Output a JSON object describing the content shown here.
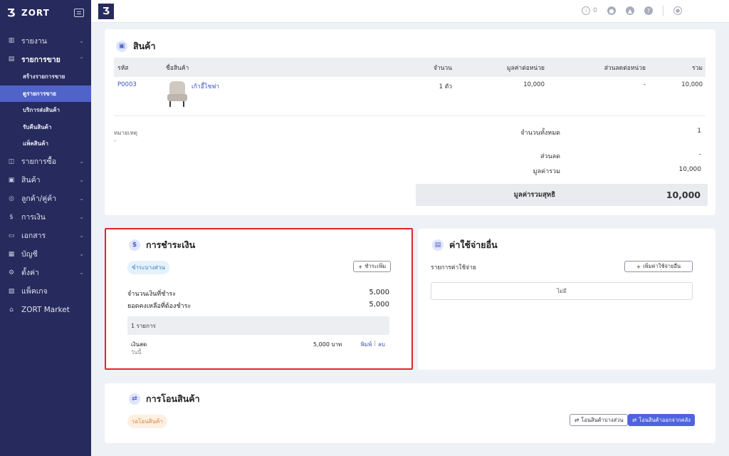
{
  "brand": {
    "name": "ZORT",
    "logo_glyph": "Ʒ"
  },
  "sidebar": {
    "items": [
      {
        "label": "รายงาน",
        "icon": "chart-bar-icon",
        "glyph": "▥"
      },
      {
        "label": "รายการขาย",
        "icon": "clipboard-icon",
        "glyph": "▤"
      },
      {
        "label": "รายการซื้อ",
        "icon": "basket-icon",
        "glyph": "◫"
      },
      {
        "label": "สินค้า",
        "icon": "box-icon",
        "glyph": "▣"
      },
      {
        "label": "ลูกค้า/คู่ค้า",
        "icon": "users-icon",
        "glyph": "◎"
      },
      {
        "label": "การเงิน",
        "icon": "dollar-circle-icon",
        "glyph": "$"
      },
      {
        "label": "เอกสาร",
        "icon": "document-icon",
        "glyph": "▭"
      },
      {
        "label": "บัญชี",
        "icon": "ledger-icon",
        "glyph": "▦"
      },
      {
        "label": "ตั้งค่า",
        "icon": "gear-icon",
        "glyph": "⚙"
      },
      {
        "label": "แพ็คเกจ",
        "icon": "package-icon",
        "glyph": "▧"
      },
      {
        "label": "ZORT Market",
        "icon": "shopping-bag-icon",
        "glyph": "⌂"
      }
    ],
    "sales_sub": [
      "สร้างรายการขาย",
      "ดูรายการขาย",
      "บริการส่งสินค้า",
      "รับคืนสินค้า",
      "แพ็คสินค้า"
    ]
  },
  "topbar": {
    "notification_count": "0"
  },
  "product": {
    "title": "สินค้า",
    "headers": {
      "code": "รหัส",
      "name": "ชื่อสินค้า",
      "qty": "จำนวน",
      "unit_price": "มูลค่าต่อหน่วย",
      "unit_discount": "ส่วนลดต่อหน่วย",
      "total": "รวม"
    },
    "row": {
      "code": "P0003",
      "name": "เก้าอี้โซฟา",
      "qty": "1 ตัว",
      "unit_price": "10,000",
      "unit_discount": "-",
      "total": "10,000"
    },
    "note_label": "หมายเหตุ",
    "note_value": "-",
    "summary": {
      "qty_label": "จำนวนทั้งหมด",
      "qty_value": "1",
      "discount_label": "ส่วนลด",
      "discount_value": "-",
      "subtotal_label": "มูลค่ารวม",
      "subtotal_value": "10,000",
      "net_label": "มูลค่ารวมสุทธิ",
      "net_value": "10,000"
    }
  },
  "payment": {
    "title": "การชำระเงิน",
    "status": "ชำระบางส่วน",
    "add_button": "ชำระเพิ่ม",
    "paid_label": "จำนวนเงินที่ชำระ",
    "paid_value": "5,000",
    "remaining_label": "ยอดคงเหลือที่ต้องชำระ",
    "remaining_value": "5,000",
    "list_header": "1 รายการ",
    "item": {
      "method": "เงินสด",
      "when": "วันนี้",
      "amount": "5,000 บาท",
      "print": "พิมพ์",
      "delete": "ลบ"
    }
  },
  "expense": {
    "title": "ค่าใช้จ่ายอื่น",
    "list_label": "รายการค่าใช้จ่าย",
    "add_button": "เพิ่มค่าใช้จ่ายอื่น",
    "empty": "ไม่มี"
  },
  "transfer": {
    "title": "การโอนสินค้า",
    "status": "รอโอนสินค้า",
    "partial_button": "โอนสินค้าบางส่วน",
    "out_button": "โอนสินค้าออกจากคลัง"
  },
  "colors": {
    "sidebar": "#262a5c",
    "accent": "#4f63c9",
    "primary_button": "#4f63e0",
    "highlight_frame": "#e0252c"
  }
}
